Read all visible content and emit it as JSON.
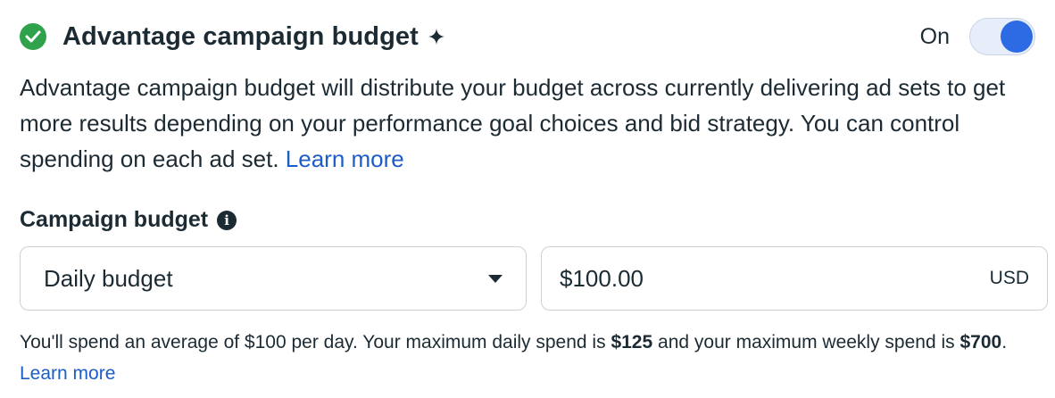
{
  "header": {
    "title": "Advantage campaign budget",
    "toggle_label": "On",
    "toggle_state": "on",
    "status_icon": "check-circle-icon",
    "title_icon": "sparkle-icon",
    "colors": {
      "check": "#31a24c",
      "toggle_on": "#2d6be4",
      "link": "#1c5dc8"
    }
  },
  "description": {
    "text": "Advantage campaign budget will distribute your budget across currently delivering ad sets to get more results depending on your performance goal choices and bid strategy. You can control spending on each ad set.",
    "link": "Learn more"
  },
  "budget": {
    "label": "Campaign budget",
    "info_icon": "i",
    "type_selected": "Daily budget",
    "amount": "$100.00",
    "currency": "USD"
  },
  "note": {
    "part1": "You'll spend an average of $100 per day. Your maximum daily spend is",
    "max_daily": "$125",
    "part2": "and your maximum weekly spend is",
    "max_weekly": "$700",
    "part3": ".",
    "link": "Learn more"
  }
}
